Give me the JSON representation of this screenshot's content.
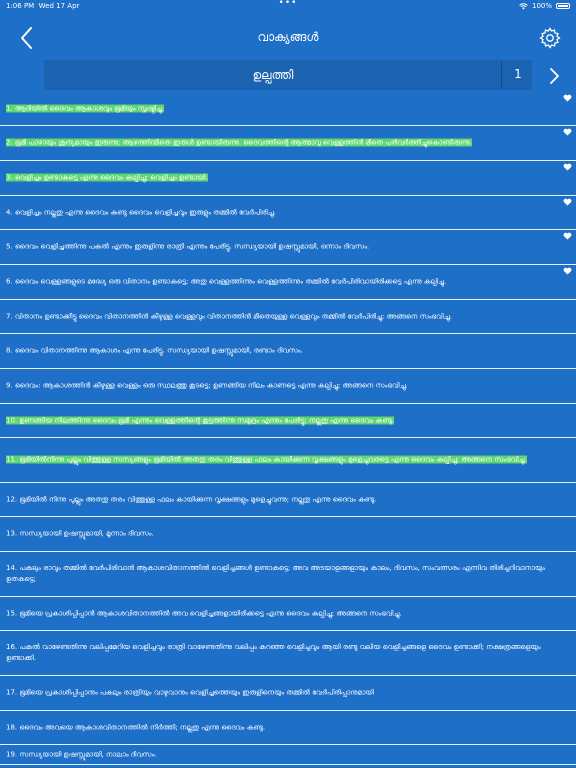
{
  "status_bar": {
    "time": "1:06 PM",
    "date": "Wed 17 Apr",
    "battery": "100%"
  },
  "header": {
    "title": "വാക്യങ്ങൾ",
    "back_icon": "chevron-left-icon",
    "settings_icon": "gear-icon"
  },
  "chapter_bar": {
    "book": "ഉല്പത്തി",
    "chapter": "1",
    "next_icon": "chevron-right-icon"
  },
  "colors": {
    "background": "#1e6fc8",
    "highlight": "#5fd66f",
    "text": "#ffffff"
  },
  "verses": [
    {
      "text": "1. ആദിയിൽ ദൈവം ആകാശവും ഭൂമിയും സൃഷ്ടിച്ചു.",
      "highlighted": true,
      "favorite": true
    },
    {
      "text": "2. ഭൂമി പാഴായും ശൂന്യമായും ഇരുന്നു; ആഴത്തിന്മീതെ ഇരുൾ ഉണ്ടായിരുന്നു. ദൈവത്തിന്റെ ആത്മാവു വെള്ളത്തിൻ മീതെ പരിവർത്തിച്ചുകൊണ്ടിരുന്നു.",
      "highlighted": true,
      "favorite": true
    },
    {
      "text": "3. വെളിച്ചം ഉണ്ടാകട്ടെ എന്നു ദൈവം കല്പിച്ചു; വെളിച്ചം ഉണ്ടായി.",
      "highlighted": true,
      "favorite": true
    },
    {
      "text": "4. വെളിച്ചം നല്ലതു എന്നു ദൈവം കണ്ടു ദൈവം വെളിച്ചവും ഇരുളും തമ്മിൽ വേർപിരിച്ചു.",
      "highlighted": false,
      "favorite": true
    },
    {
      "text": "5. ദൈവം വെളിച്ചത്തിന്നു പകൽ എന്നും ഇരുളിന്നു രാത്രി എന്നും പേരിട്ടു. സന്ധ്യയായി ഉഷസ്സുമായി, ഒന്നാം ദിവസം.",
      "highlighted": false,
      "favorite": true
    },
    {
      "text": "6. ദൈവം വെള്ളങ്ങളുടെ മദ്ധ്യേ ഒരു വിതാനം ഉണ്ടാകട്ടെ; അതു വെള്ളത്തിന്നും വെള്ളത്തിന്നും തമ്മിൽ വേർപിരിവായിരിക്കട്ടെ എന്നു കല്പിച്ചു.",
      "highlighted": false,
      "favorite": true
    },
    {
      "text": "7. വിതാനം ഉണ്ടാക്കീട്ടു ദൈവം വിതാനത്തിൻ കീഴുള്ള വെള്ളവും വിതാനത്തിൻ മീതെയുള്ള വെള്ളവും തമ്മിൽ വേർപിരിച്ചു; അങ്ങനെ സംഭവിച്ചു.",
      "highlighted": false,
      "favorite": false
    },
    {
      "text": "8. ദൈവം വിതാനത്തിന്നു ആകാശം എന്നു പേരിട്ടു. സന്ധ്യയായി ഉഷസ്സുമായി, രണ്ടാം ദിവസം.",
      "highlighted": false,
      "favorite": false
    },
    {
      "text": "9. ദൈവം: ആകാശത്തിൻ കീഴുള്ള വെള്ളം ഒരു സ്ഥലത്തു കൂടട്ടെ; ഉണങ്ങിയ നിലം കാണട്ടെ എന്നു കല്പിച്ചു; അങ്ങനെ സംഭവിച്ചു.",
      "highlighted": false,
      "favorite": false
    },
    {
      "text": "10. ഉണങ്ങിയ നിലത്തിന്നു ദൈവം ഭൂമി എന്നും വെള്ളത്തിന്റെ കൂട്ടത്തിന്നു സമുദ്രം എന്നും പേരിട്ടു; നല്ലതു എന്നു ദൈവം കണ്ടു.",
      "highlighted": true,
      "favorite": false
    },
    {
      "text": "11. ഭൂമിയിൽനിന്നു പുല്ലും വിത്തുള്ള സസ്യങ്ങളും ഭൂമിയിൽ അതതു തരം വിത്തുള്ള ഫലം കായിക്കുന്ന വൃക്ഷങ്ങളും മുളെച്ചുവരട്ടെ എന്നു ദൈവം കല്പിച്ചു; അങ്ങനെ സംഭവിച്ചു.",
      "highlighted": true,
      "favorite": false
    },
    {
      "text": "12. ഭൂമിയിൽ നിന്നു പുല്ലും അതതു തരം വിത്തുള്ള ഫലം കായിക്കുന്ന വൃക്ഷങ്ങളും മുളെച്ചുവന്നു; നല്ലതു എന്നു ദൈവം കണ്ടു.",
      "highlighted": false,
      "favorite": false
    },
    {
      "text": "13. സന്ധ്യയായി ഉഷസ്സുമായി, മൂന്നാം ദിവസം.",
      "highlighted": false,
      "favorite": false
    },
    {
      "text": "14. പകലും രാവും തമ്മിൽ വേർപിരിവാൻ ആകാശവിതാനത്തിൽ വെളിച്ചങ്ങൾ ഉണ്ടാകട്ടെ; അവ അടയാളങ്ങളായും കാലം, ദിവസം, സംവത്സരം എന്നിവ തിരിച്ചറിവാനായും ഉതകട്ടെ;",
      "highlighted": false,
      "favorite": false
    },
    {
      "text": "15. ഭൂമിയെ പ്രകാശിപ്പിപ്പാൻ ആകാശവിതാനത്തിൽ അവ വെളിച്ചങ്ങളായിരിക്കട്ടെ എന്നു ദൈവം കല്പിച്ചു; അങ്ങനെ സംഭവിച്ചു.",
      "highlighted": false,
      "favorite": false
    },
    {
      "text": "16. പകൽ വാഴേണ്ടതിന്നു വലിപ്പമേറിയ വെളിച്ചവും രാത്രി വാഴേണ്ടതിന്നു വലിപ്പം കുറഞ്ഞ വെളിച്ചവും ആയി രണ്ടു വലിയ വെളിച്ചങ്ങളെ ദൈവം ഉണ്ടാക്കി; നക്ഷത്രങ്ങളെയും ഉണ്ടാക്കി.",
      "highlighted": false,
      "favorite": false
    },
    {
      "text": "17. ഭൂമിയെ പ്രകാശിപ്പിപ്പാനും പകലും രാത്രിയും വാഴുവാനും വെളിച്ചത്തെയും ഇരുളിനെയും തമ്മിൽ വേർപിരിപ്പാനുമായി",
      "highlighted": false,
      "favorite": false
    },
    {
      "text": "18. ദൈവം അവയെ ആകാശവിതാനത്തിൽ നിർത്തി; നല്ലതു എന്നു ദൈവം കണ്ടു.",
      "highlighted": false,
      "favorite": false
    },
    {
      "text": "19. സന്ധ്യയായി ഉഷസ്സുമായി, നാലാം ദിവസം.",
      "highlighted": false,
      "favorite": false
    }
  ]
}
